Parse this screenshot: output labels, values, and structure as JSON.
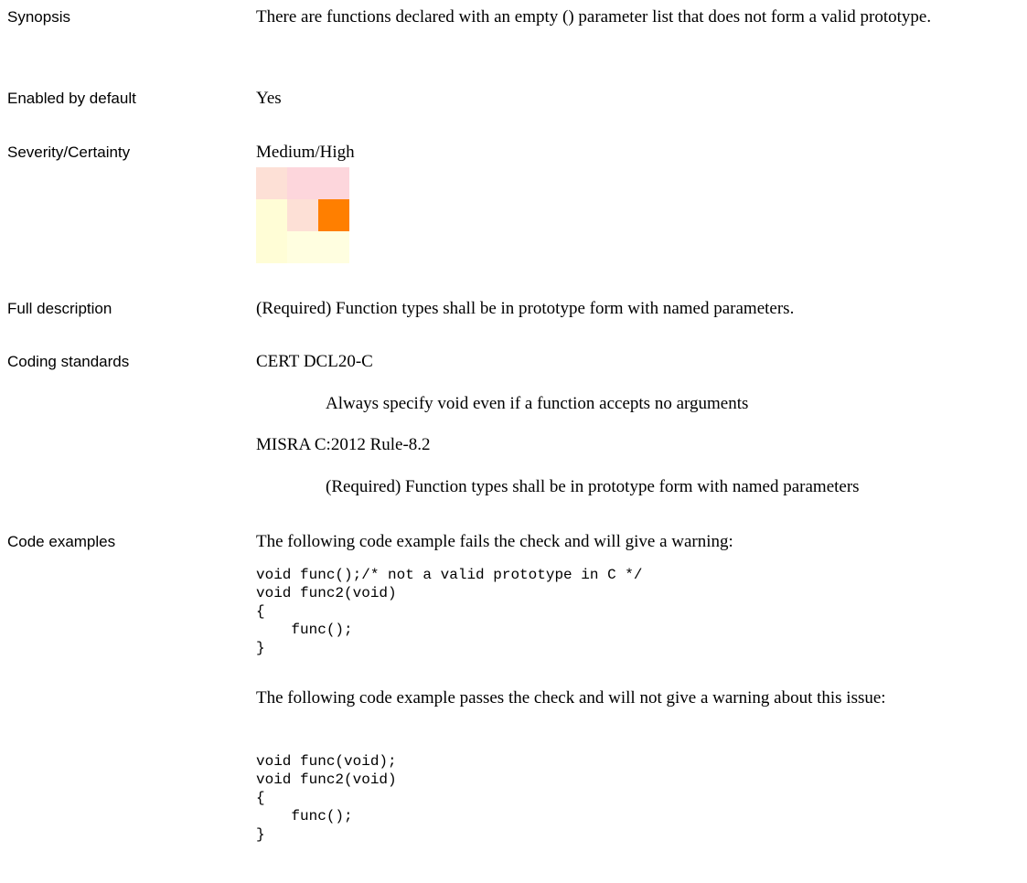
{
  "labels": {
    "synopsis": "Synopsis",
    "enabled": "Enabled by default",
    "severity": "Severity/Certainty",
    "full_description": "Full description",
    "coding_standards": "Coding standards",
    "code_examples": "Code examples"
  },
  "synopsis": "There are functions declared with an empty () parameter list that does not form a valid prototype.",
  "enabled": "Yes",
  "severity": {
    "text": "Medium/High",
    "severity_level": "Medium",
    "certainty_level": "High",
    "grid_colors": [
      [
        "#fde0d6",
        "#fdd6dc",
        "#fdd6dc"
      ],
      [
        "#fffdd6",
        "#fde0d6",
        "#ff7f00"
      ],
      [
        "#fffdd6",
        "#fffee0",
        "#fffee0"
      ]
    ]
  },
  "full_description": "(Required) Function types shall be in prototype form with named parameters.",
  "coding_standards": [
    {
      "name": "CERT DCL20-C",
      "description": "Always specify void even if a function accepts no arguments"
    },
    {
      "name": "MISRA C:2012 Rule-8.2",
      "description": "(Required) Function types shall be in prototype form with named parameters"
    }
  ],
  "code_examples": {
    "fail_intro": "The following code example fails the check and will give a warning:",
    "fail_code": "void func();/* not a valid prototype in C */\nvoid func2(void)\n{\n    func();\n}",
    "pass_intro": "The following code example passes the check and will not give a warning about this issue:",
    "pass_code": "void func(void);\nvoid func2(void)\n{\n    func();\n}"
  }
}
